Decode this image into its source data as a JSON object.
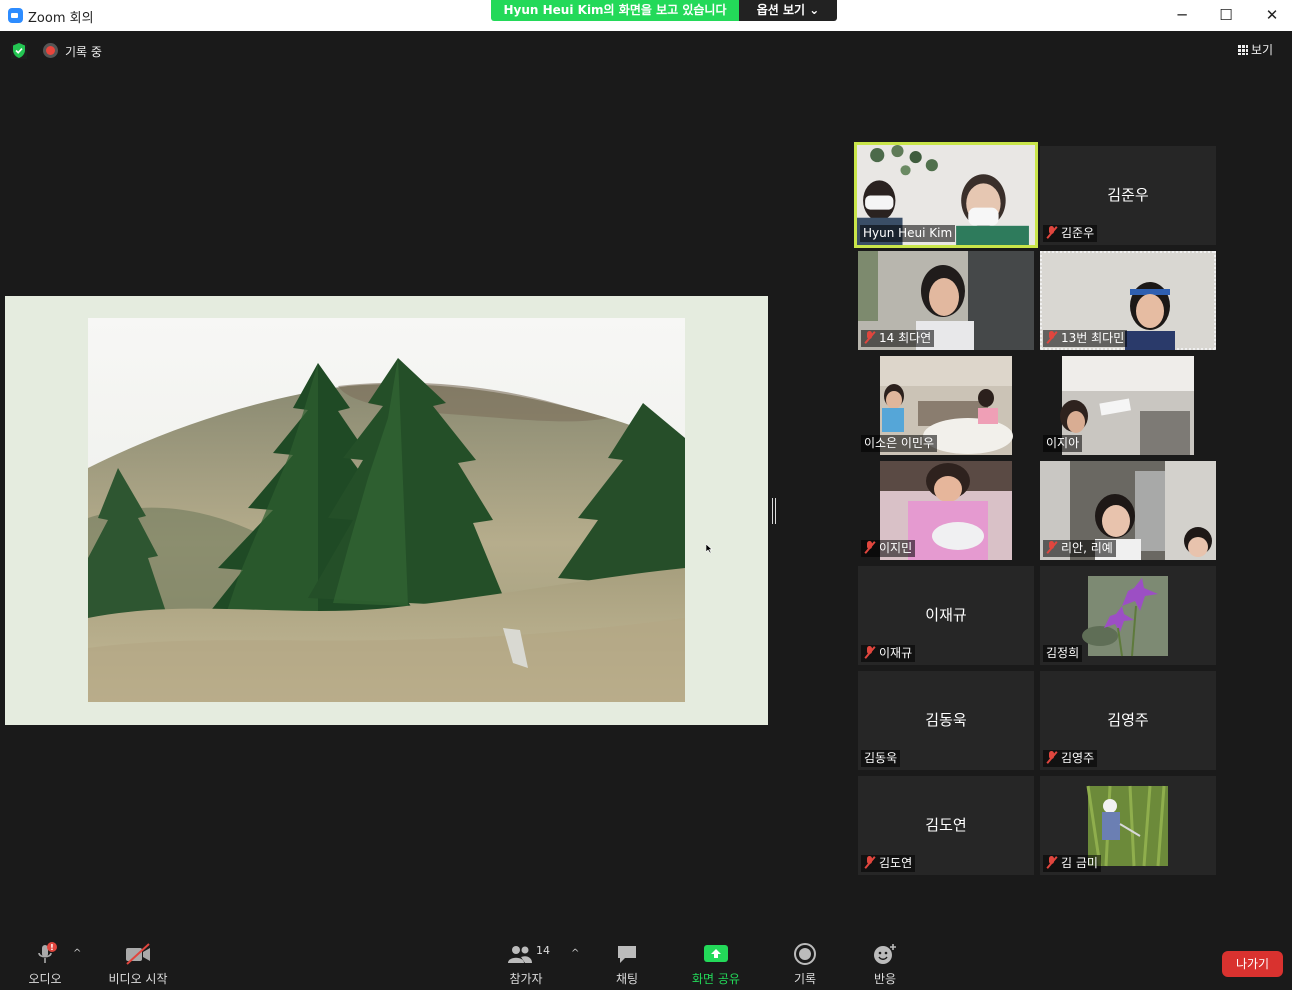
{
  "window": {
    "title": "Zoom 회의",
    "share_banner": "Hyun Heui Kim의 화면을 보고 있습니다",
    "view_options": "옵션 보기 ⌄",
    "minimize": "─",
    "maximize": "☐",
    "close": "✕"
  },
  "status": {
    "recording_label": "기록 중",
    "view_label": "보기"
  },
  "gallery": [
    {
      "id": "hyun",
      "label": "Hyun Heui Kim",
      "big": "",
      "muted": false,
      "video": true
    },
    {
      "id": "kimjunwoo",
      "label": "김준우",
      "big": "김준우",
      "muted": true,
      "video": false
    },
    {
      "id": "choidayeon",
      "label": "14 최다연",
      "big": "",
      "muted": true,
      "video": true
    },
    {
      "id": "choidamin",
      "label": "13번 최다민",
      "big": "",
      "muted": true,
      "video": true
    },
    {
      "id": "leesoeun",
      "label": "이소은 이민우",
      "big": "",
      "muted": false,
      "video": true
    },
    {
      "id": "leejia",
      "label": "이지아",
      "big": "",
      "muted": false,
      "video": true
    },
    {
      "id": "leejimin",
      "label": "이지민",
      "big": "",
      "muted": true,
      "video": true
    },
    {
      "id": "rian",
      "label": "리안, 리예",
      "big": "",
      "muted": true,
      "video": true
    },
    {
      "id": "leejaegyu",
      "label": "이재규",
      "big": "이재규",
      "muted": true,
      "video": false
    },
    {
      "id": "kimjeonghui",
      "label": "김정희",
      "big": "",
      "muted": false,
      "video": true
    },
    {
      "id": "kimdonguk",
      "label": "김동욱",
      "big": "김동욱",
      "muted": false,
      "video": false
    },
    {
      "id": "kimyeongju",
      "label": "김영주",
      "big": "김영주",
      "muted": true,
      "video": false
    },
    {
      "id": "kimdoyeon",
      "label": "김도연",
      "big": "김도연",
      "muted": true,
      "video": false
    },
    {
      "id": "kimgeummi",
      "label": "김 금미",
      "big": "",
      "muted": true,
      "video": true
    }
  ],
  "toolbar": {
    "audio_label": "오디오",
    "video_label": "비디오 시작",
    "participants_label": "참가자",
    "participants_count": "14",
    "chat_label": "채팅",
    "share_label": "화면 공유",
    "record_label": "기록",
    "reactions_label": "반응",
    "leave_label": "나가기"
  },
  "colors": {
    "share_green": "#23d959",
    "active_speaker": "#c9e54a",
    "leave_red": "#d9322f",
    "muted_red": "#e0463e"
  }
}
